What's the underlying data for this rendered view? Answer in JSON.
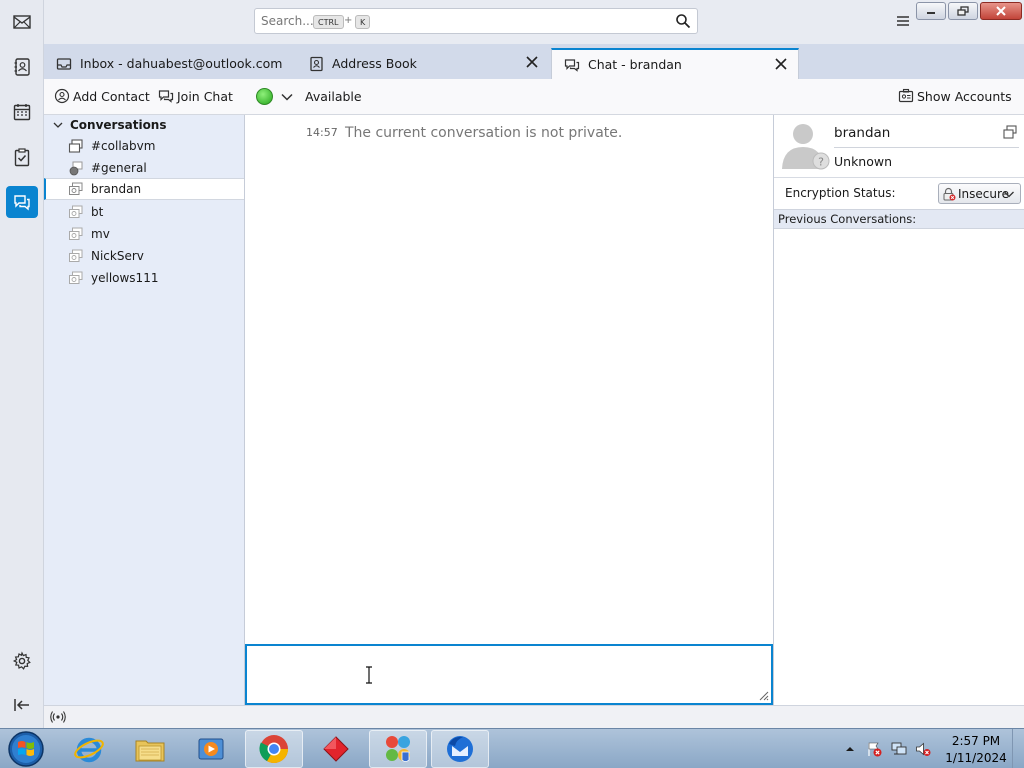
{
  "search": {
    "placeholder": "Search...",
    "key1": "CTRL",
    "plus": "+",
    "key2": "K"
  },
  "tabs": [
    {
      "label": "Inbox - dahuabest@outlook.com",
      "icon": "inbox-icon"
    },
    {
      "label": "Address Book",
      "icon": "address-book-icon"
    },
    {
      "label": "Chat - brandan",
      "icon": "chat-icon",
      "selected": true
    }
  ],
  "toolbar": {
    "add_contact": "Add Contact",
    "join_chat": "Join Chat",
    "status": "Available",
    "show_accounts": "Show Accounts"
  },
  "conversations": {
    "header": "Conversations",
    "items": [
      {
        "name": "#collabvm"
      },
      {
        "name": "#general"
      },
      {
        "name": "brandan",
        "selected": true
      },
      {
        "name": "bt"
      },
      {
        "name": "mv"
      },
      {
        "name": "NickServ"
      },
      {
        "name": "yellows111"
      }
    ]
  },
  "messages": [
    {
      "time": "14:57",
      "text": "The current conversation is not private."
    }
  ],
  "buddy": {
    "name": "brandan",
    "status": "Unknown",
    "encryption_label": "Encryption Status:",
    "encryption_value": "Insecure",
    "previous_conversations": "Previous Conversations:"
  },
  "taskbar": {
    "time": "2:57 PM",
    "date": "1/11/2024"
  },
  "colors": {
    "accent": "#0a84d0",
    "status_available": "#25a51c"
  }
}
